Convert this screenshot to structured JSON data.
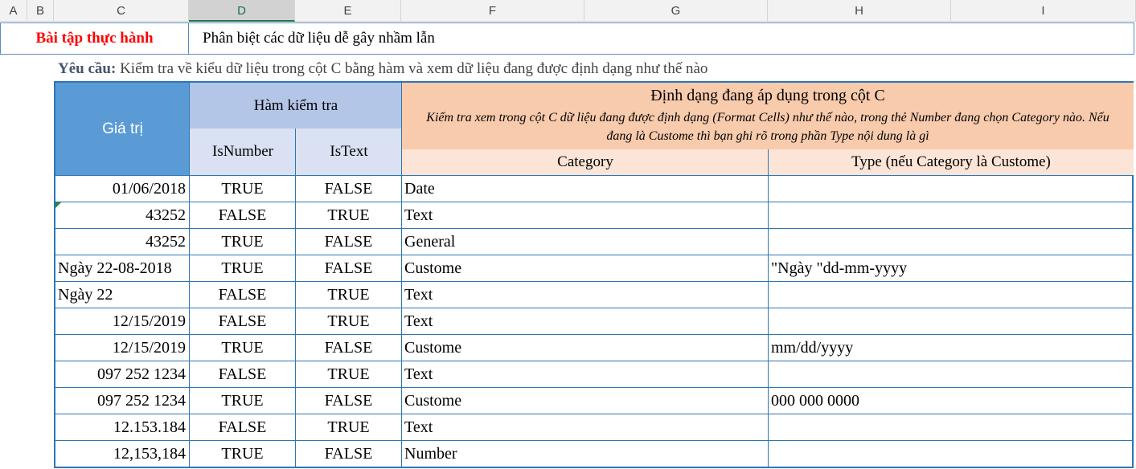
{
  "column_headers": [
    "A",
    "B",
    "C",
    "D",
    "E",
    "F",
    "G",
    "H",
    "I"
  ],
  "selected_column": "D",
  "title": {
    "left": "Bài tập thực hành",
    "right": "Phân biệt các dữ liệu dễ gây nhầm lẫn"
  },
  "requirement": {
    "label": "Yêu cầu:",
    "text": " Kiểm tra về kiểu dữ liệu trong cột C bằng hàm và xem dữ liệu đang được định dạng như thế nào"
  },
  "table_headers": {
    "gia_tri": "Giá trị",
    "ham_kiem_tra": "Hàm kiểm tra",
    "isnumber": "IsNumber",
    "istext": "IsText",
    "dinh_dang_title": "Định dạng đang áp dụng trong cột C",
    "dinh_dang_note": "Kiểm tra xem trong cột C dữ liệu đang được định dạng (Format Cells) như thế nào, trong thẻ Number đang chọn Category nào. Nếu đang là Custome thì bạn ghi rõ trong phần Type nội dung là gì",
    "category": "Category",
    "type": "Type (nếu Category là Custome)"
  },
  "rows": [
    {
      "value": "01/06/2018",
      "align": "right",
      "isnumber": "TRUE",
      "istext": "FALSE",
      "category": "Date",
      "type": ""
    },
    {
      "value": "43252",
      "align": "right",
      "isnumber": "FALSE",
      "istext": "TRUE",
      "category": "Text",
      "type": ""
    },
    {
      "value": "43252",
      "align": "right",
      "isnumber": "TRUE",
      "istext": "FALSE",
      "category": "General",
      "type": ""
    },
    {
      "value": "Ngày 22-08-2018",
      "align": "left",
      "isnumber": "TRUE",
      "istext": "FALSE",
      "category": "Custome",
      "type": "\"Ngày \"dd-mm-yyyy"
    },
    {
      "value": "Ngày 22",
      "align": "left",
      "isnumber": "FALSE",
      "istext": "TRUE",
      "category": "Text",
      "type": ""
    },
    {
      "value": "12/15/2019",
      "align": "right",
      "isnumber": "FALSE",
      "istext": "TRUE",
      "category": "Text",
      "type": ""
    },
    {
      "value": "12/15/2019",
      "align": "right",
      "isnumber": "TRUE",
      "istext": "FALSE",
      "category": "Custome",
      "type": "mm/dd/yyyy"
    },
    {
      "value": "097 252 1234",
      "align": "right",
      "isnumber": "FALSE",
      "istext": "TRUE",
      "category": "Text",
      "type": ""
    },
    {
      "value": "097 252 1234",
      "align": "right",
      "isnumber": "TRUE",
      "istext": "FALSE",
      "category": "Custome",
      "type": "000 000 0000"
    },
    {
      "value": "12.153.184",
      "align": "right",
      "isnumber": "FALSE",
      "istext": "TRUE",
      "category": "Text",
      "type": ""
    },
    {
      "value": "12,153,184",
      "align": "right",
      "isnumber": "TRUE",
      "istext": "FALSE",
      "category": "Number",
      "type": ""
    }
  ],
  "colors": {
    "title_red": "#ff0000",
    "header_blue": "#5b9bd5",
    "header_light_blue": "#b4c6e7",
    "header_lighter_blue": "#d9e1f2",
    "header_orange": "#f8cbad",
    "header_light_orange": "#fce4d6",
    "border_blue": "#2e75b6"
  }
}
